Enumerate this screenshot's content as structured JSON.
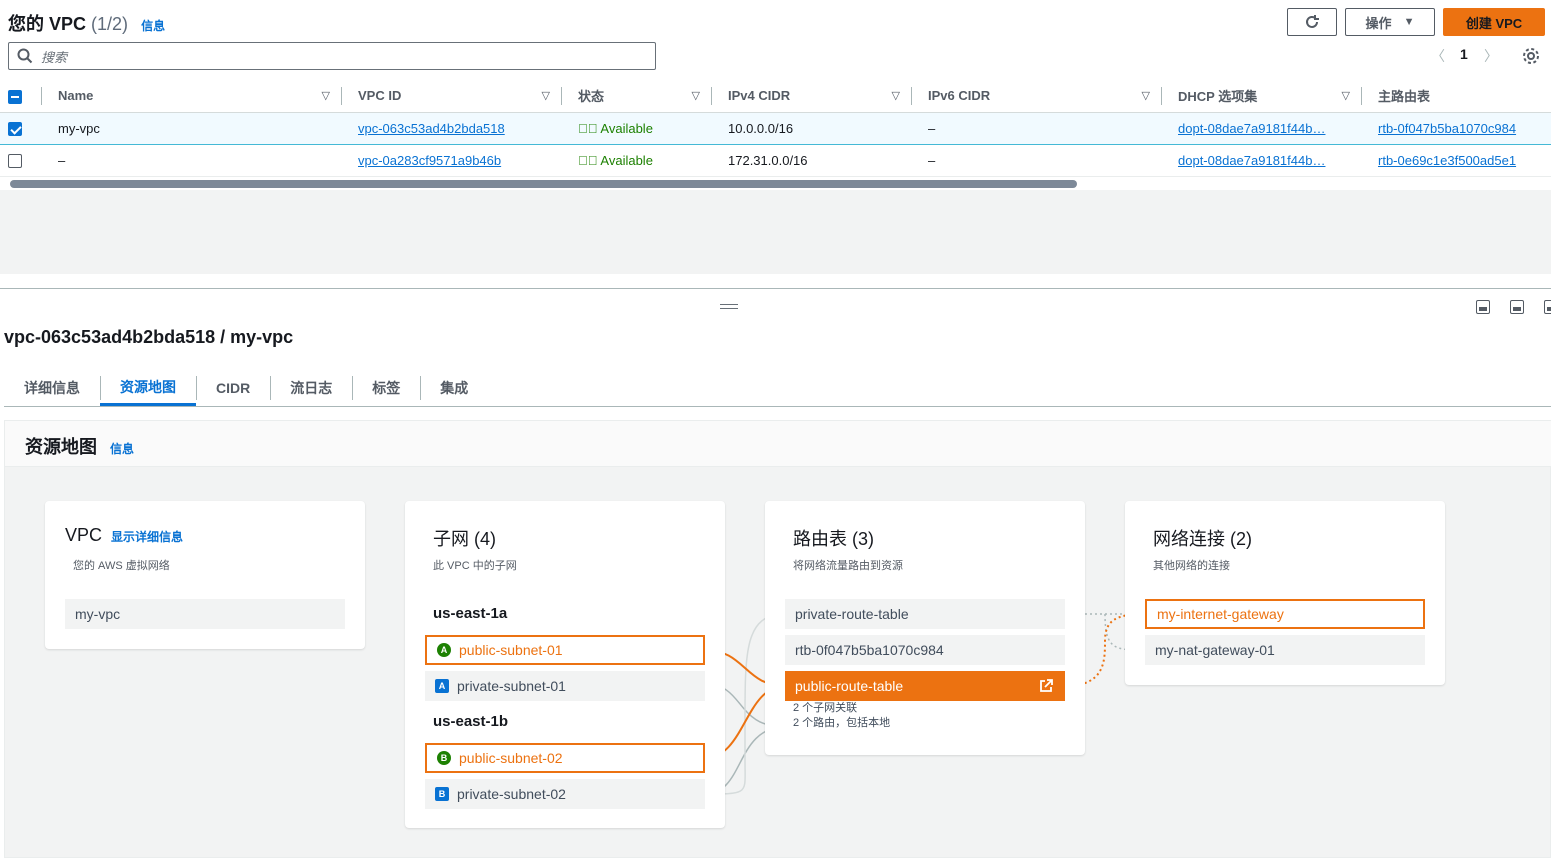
{
  "header": {
    "title": "您的 VPC",
    "count": "(1/2)",
    "info": "信息",
    "actions_label": "操作",
    "create_label": "创建 VPC",
    "search_placeholder": "搜索",
    "page": "1"
  },
  "table": {
    "columns": [
      "Name",
      "VPC ID",
      "状态",
      "IPv4 CIDR",
      "IPv6 CIDR",
      "DHCP 选项集",
      "主路由表"
    ],
    "rows": [
      {
        "name": "my-vpc",
        "vpc_id": "vpc-063c53ad4b2bda518",
        "status": "Available",
        "ipv4": "10.0.0.0/16",
        "ipv6": "–",
        "dhcp": "dopt-08dae7a9181f44b…",
        "rtb": "rtb-0f047b5ba1070c984",
        "selected": true
      },
      {
        "name": "–",
        "vpc_id": "vpc-0a283cf9571a9b46b",
        "status": "Available",
        "ipv4": "172.31.0.0/16",
        "ipv6": "–",
        "dhcp": "dopt-08dae7a9181f44b…",
        "rtb": "rtb-0e69c1e3f500ad5e1",
        "selected": false
      }
    ]
  },
  "detail": {
    "heading": "vpc-063c53ad4b2bda518 / my-vpc",
    "tabs": [
      "详细信息",
      "资源地图",
      "CIDR",
      "流日志",
      "标签",
      "集成"
    ],
    "active_tab": "资源地图"
  },
  "resource_map": {
    "title": "资源地图",
    "info": "信息",
    "vpc_card": {
      "title": "VPC",
      "link": "显示详细信息",
      "sub": "您的 AWS 虚拟网络",
      "item": "my-vpc"
    },
    "subnet_card": {
      "title": "子网 (4)",
      "sub": "此 VPC 中的子网",
      "az1": "us-east-1a",
      "az2": "us-east-1b",
      "s1": "public-subnet-01",
      "s1_badge": "A",
      "s2": "private-subnet-01",
      "s2_badge": "A",
      "s3": "public-subnet-02",
      "s3_badge": "B",
      "s4": "private-subnet-02",
      "s4_badge": "B"
    },
    "route_card": {
      "title": "路由表 (3)",
      "sub": "将网络流量路由到资源",
      "r1": "private-route-table",
      "r2": "rtb-0f047b5ba1070c984",
      "r3": "public-route-table",
      "note1": "2 个子网关联",
      "note2": "2 个路由，包括本地"
    },
    "conn_card": {
      "title": "网络连接 (2)",
      "sub": "其他网络的连接",
      "c1": "my-internet-gateway",
      "c2": "my-nat-gateway-01"
    }
  },
  "colors": {
    "accent": "#ec7211",
    "link": "#0972d3",
    "success": "#1d8102"
  }
}
